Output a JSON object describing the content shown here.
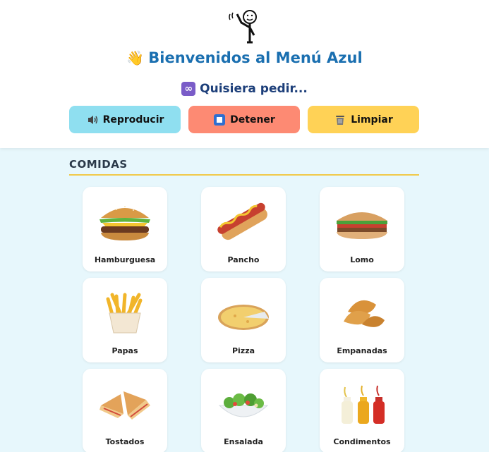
{
  "header": {
    "title": "Bienvenidos al Menú Azul",
    "title_emoji": "👋",
    "subtitle": "Quisiera pedir...",
    "subtitle_icon": "∞"
  },
  "controls": {
    "play_label": "Reproducir",
    "stop_label": "Detener",
    "clear_label": "Limpiar"
  },
  "section": {
    "title": "COMIDAS"
  },
  "items": [
    {
      "label": "Hamburguesa",
      "icon": "hamburger-icon"
    },
    {
      "label": "Pancho",
      "icon": "hotdog-icon"
    },
    {
      "label": "Lomo",
      "icon": "sandwich-icon"
    },
    {
      "label": "Papas",
      "icon": "fries-icon"
    },
    {
      "label": "Pizza",
      "icon": "pizza-icon"
    },
    {
      "label": "Empanadas",
      "icon": "empanada-icon"
    },
    {
      "label": "Tostados",
      "icon": "toast-icon"
    },
    {
      "label": "Ensalada",
      "icon": "salad-icon"
    },
    {
      "label": "Condimentos",
      "icon": "condiments-icon"
    }
  ],
  "colors": {
    "play": "#8fdff0",
    "stop": "#fd8a73",
    "clear": "#ffd256",
    "title": "#1a6fb0",
    "background": "#e7f7fc"
  }
}
